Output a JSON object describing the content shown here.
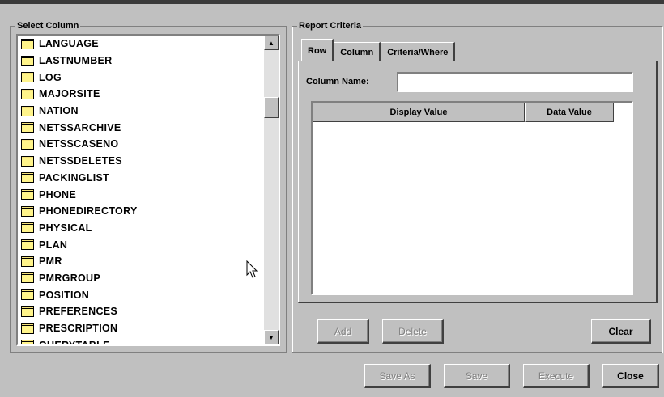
{
  "select_column": {
    "title": "Select Column",
    "items": [
      "LANGUAGE",
      "LASTNUMBER",
      "LOG",
      "MAJORSITE",
      "NATION",
      "NETSSARCHIVE",
      "NETSSCASENO",
      "NETSSDELETES",
      "PACKINGLIST",
      "PHONE",
      "PHONEDIRECTORY",
      "PHYSICAL",
      "PLAN",
      "PMR",
      "PMRGROUP",
      "POSITION",
      "PREFERENCES",
      "PRESCRIPTION",
      "QUERYTABLE"
    ]
  },
  "report_criteria": {
    "title": "Report Criteria",
    "tabs": [
      "Row",
      "Column",
      "Criteria/Where"
    ],
    "active_tab": "Row",
    "column_name_label": "Column Name:",
    "column_name_value": "",
    "grid_headers": [
      "Display Value",
      "Data Value"
    ],
    "add_label": "Add",
    "delete_label": "Delete",
    "clear_label": "Clear"
  },
  "footer": {
    "save_as_label": "Save As",
    "save_label": "Save",
    "execute_label": "Execute",
    "close_label": "Close"
  },
  "icons": {
    "folder": "folder-icon",
    "scroll_up": "arrow-up-icon",
    "scroll_down": "arrow-down-icon",
    "cursor": "mouse-pointer-icon"
  }
}
